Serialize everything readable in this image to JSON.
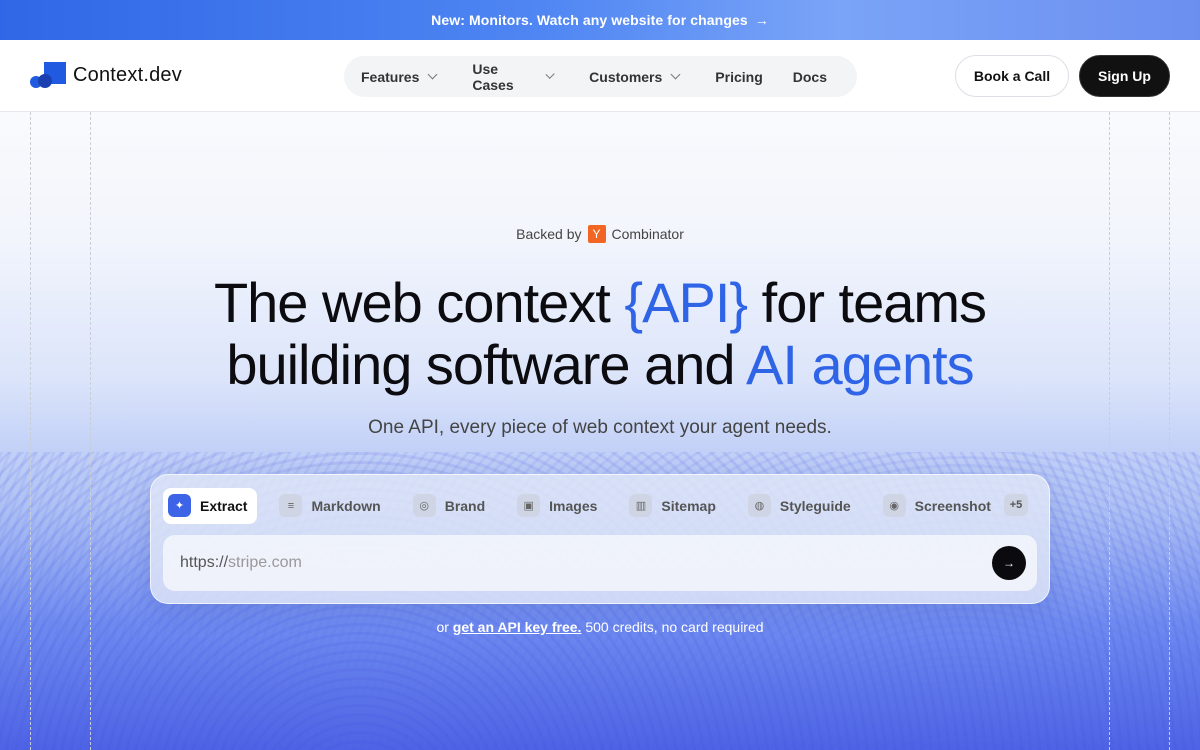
{
  "announcement": {
    "text": "New: Monitors. Watch any website for changes",
    "arrow": "→"
  },
  "nav": {
    "logo_text": "Context.dev",
    "menu": [
      {
        "label": "Features",
        "dropdown": true
      },
      {
        "label": "Use Cases",
        "dropdown": true
      },
      {
        "label": "Customers",
        "dropdown": true
      },
      {
        "label": "Pricing",
        "dropdown": false
      },
      {
        "label": "Docs",
        "dropdown": false
      }
    ],
    "book_call": "Book a Call",
    "sign_up": "Sign Up"
  },
  "hero": {
    "backed_prefix": "Backed by",
    "yc_letter": "Y",
    "backed_suffix": "Combinator",
    "headline_1a": "The web context ",
    "headline_1b": "{API}",
    "headline_1c": " for teams",
    "headline_2a": "building software and ",
    "headline_2b": "AI agents",
    "subtitle": "One API, every piece of web context your agent needs."
  },
  "tool": {
    "tabs": [
      {
        "label": "Extract",
        "icon": "sparkle-icon",
        "glyph": "✦",
        "active": true
      },
      {
        "label": "Markdown",
        "icon": "markdown-icon",
        "glyph": "≡",
        "active": false
      },
      {
        "label": "Brand",
        "icon": "brand-icon",
        "glyph": "◎",
        "active": false
      },
      {
        "label": "Images",
        "icon": "image-icon",
        "glyph": "▣",
        "active": false
      },
      {
        "label": "Sitemap",
        "icon": "map-icon",
        "glyph": "▥",
        "active": false
      },
      {
        "label": "Styleguide",
        "icon": "palette-icon",
        "glyph": "◍",
        "active": false
      },
      {
        "label": "Screenshot",
        "icon": "camera-icon",
        "glyph": "◉",
        "active": false
      }
    ],
    "more": "+5",
    "input_prefix": "https://",
    "input_placeholder": "stripe.com",
    "submit_glyph": "→"
  },
  "cta": {
    "prefix": "or ",
    "link": "get an API key free.",
    "suffix": " 500 credits, no card required"
  },
  "colors": {
    "accent": "#2f64e6",
    "yc": "#f26522",
    "dark": "#111111"
  }
}
